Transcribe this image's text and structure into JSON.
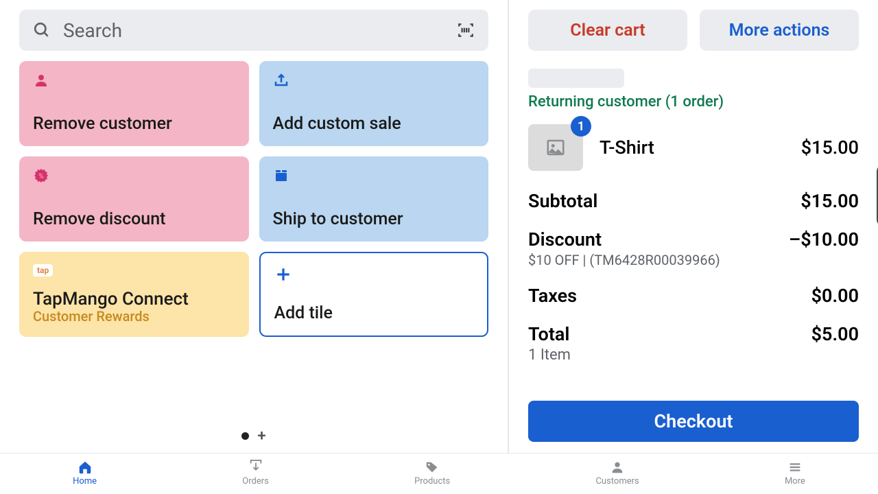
{
  "search": {
    "placeholder": "Search"
  },
  "tiles": {
    "remove_customer": "Remove customer",
    "add_custom_sale": "Add custom sale",
    "remove_discount": "Remove discount",
    "ship_to_customer": "Ship to customer",
    "tapmango_title": "TapMango Connect",
    "tapmango_sub": "Customer Rewards",
    "tapmango_tag": "tap",
    "add_tile": "Add tile"
  },
  "actions": {
    "clear": "Clear cart",
    "more": "More actions"
  },
  "customer": {
    "returning": "Returning customer (1 order)"
  },
  "cart": {
    "items": [
      {
        "name": "T-Shirt",
        "price": "$15.00",
        "qty": "1"
      }
    ],
    "subtotal_label": "Subtotal",
    "subtotal_value": "$15.00",
    "discount_label": "Discount",
    "discount_detail": "$10 OFF | (TM6428R00039966)",
    "discount_value": "–$10.00",
    "taxes_label": "Taxes",
    "taxes_value": "$0.00",
    "total_label": "Total",
    "total_sub": "1 Item",
    "total_value": "$5.00",
    "checkout": "Checkout"
  },
  "nav": {
    "home": "Home",
    "orders": "Orders",
    "products": "Products",
    "customers": "Customers",
    "more": "More"
  }
}
